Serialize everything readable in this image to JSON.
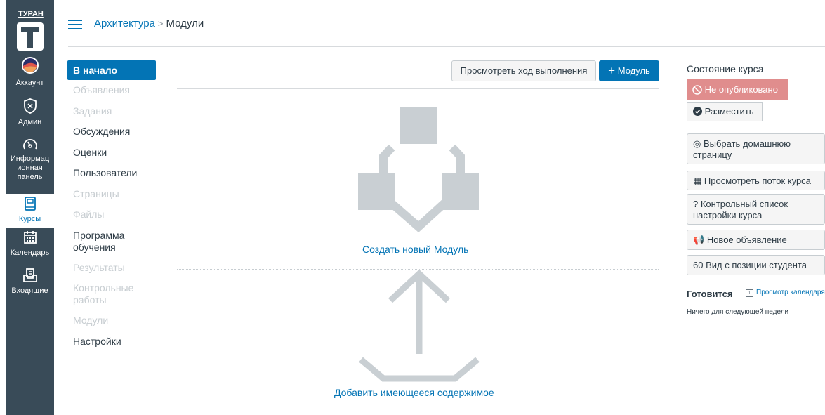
{
  "global_nav": {
    "logo_text": "ТУРАН",
    "items": [
      {
        "label": "Аккаунт",
        "icon": "account-avatar-icon"
      },
      {
        "label": "Админ",
        "icon": "shield-icon"
      },
      {
        "label": "Информационная панель",
        "label_lines": [
          "Информац",
          "ионная",
          "панель"
        ],
        "icon": "dashboard-gauge-icon"
      },
      {
        "label": "Курсы",
        "icon": "courses-book-icon",
        "active": true
      },
      {
        "label": "Календарь",
        "icon": "calendar-icon"
      },
      {
        "label": "Входящие",
        "icon": "inbox-icon"
      }
    ]
  },
  "header": {
    "breadcrumb_course": "Архитектура",
    "breadcrumb_separator": ">",
    "breadcrumb_page": "Модули"
  },
  "course_nav": [
    {
      "label": "В начало",
      "state": "active"
    },
    {
      "label": "Объявления",
      "state": "disabled"
    },
    {
      "label": "Задания",
      "state": "disabled"
    },
    {
      "label": "Обсуждения",
      "state": "enabled"
    },
    {
      "label": "Оценки",
      "state": "enabled"
    },
    {
      "label": "Пользователи",
      "state": "enabled"
    },
    {
      "label": "Страницы",
      "state": "disabled"
    },
    {
      "label": "Файлы",
      "state": "disabled"
    },
    {
      "label": "Программа обучения",
      "label_lines": [
        "Программа",
        "обучения"
      ],
      "state": "enabled"
    },
    {
      "label": "Результаты",
      "state": "disabled"
    },
    {
      "label": "Контрольные работы",
      "label_lines": [
        "Контрольные",
        "работы"
      ],
      "state": "disabled"
    },
    {
      "label": "Модули",
      "state": "disabled"
    },
    {
      "label": "Настройки",
      "state": "enabled"
    }
  ],
  "main": {
    "view_progress_label": "Просмотреть ход выполнения",
    "add_module_label": "Модуль",
    "create_module_link": "Создать новый Модуль",
    "add_content_link": "Добавить имеющееся содержимое"
  },
  "sidebar": {
    "course_status_title": "Состояние курса",
    "unpublished_label": "Не опубликовано",
    "publish_label": "Разместить",
    "home_page_label": "Выбрать домашнюю страницу",
    "home_page_lines": [
      "Выбрать домашнюю",
      "страницу"
    ],
    "course_stream_label": "Просмотреть поток курса",
    "checklist_label": "Контрольный список настройки курса",
    "checklist_lines": [
      "Контрольный список",
      "настройки курса"
    ],
    "new_announcement_label": "Новое объявление",
    "student_view_label": "Вид с позиции студента",
    "coming_up_title": "Готовится",
    "view_calendar_label": "Просмотр календаря",
    "nothing_label": "Ничего для следующей недели"
  },
  "colors": {
    "nav_bg": "#394b58",
    "brand_blue": "#0374b5",
    "unpublished_bg": "#e08d8d",
    "illustration_gray": "#c9cfd3"
  }
}
